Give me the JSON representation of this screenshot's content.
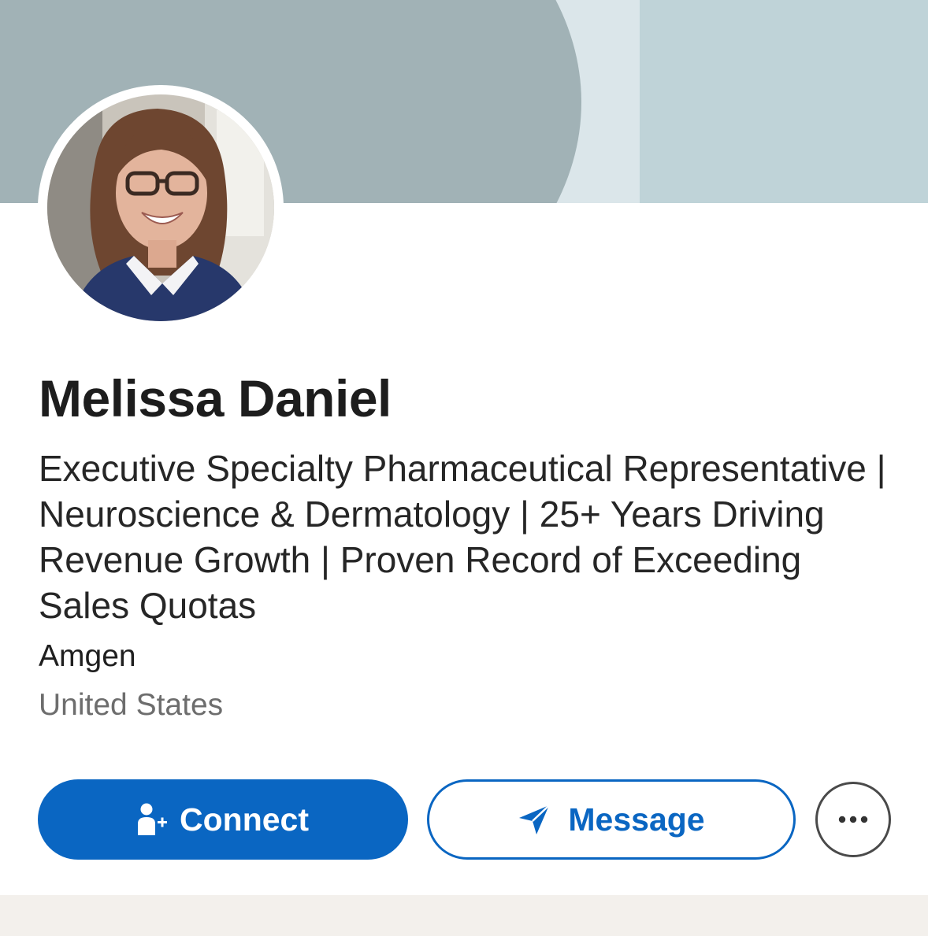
{
  "profile": {
    "name": "Melissa Daniel",
    "headline": "Executive Specialty Pharmaceutical Representative | Neuroscience & Dermatology | 25+ Years Driving Revenue Growth | Proven Record of Exceeding Sales Quotas",
    "company": "Amgen",
    "location": "United States"
  },
  "actions": {
    "connect_label": "Connect",
    "connect_icon": "add-person-icon",
    "message_label": "Message",
    "message_icon": "send-icon",
    "more_icon": "more-dots-icon"
  },
  "colors": {
    "primary": "#0a66c2",
    "cover_dark": "#a1b2b6",
    "cover_light": "#bfd3d8",
    "text_primary": "#1d1d1d",
    "text_secondary": "#6d6d6d",
    "footer_band": "#f3f0ec"
  }
}
